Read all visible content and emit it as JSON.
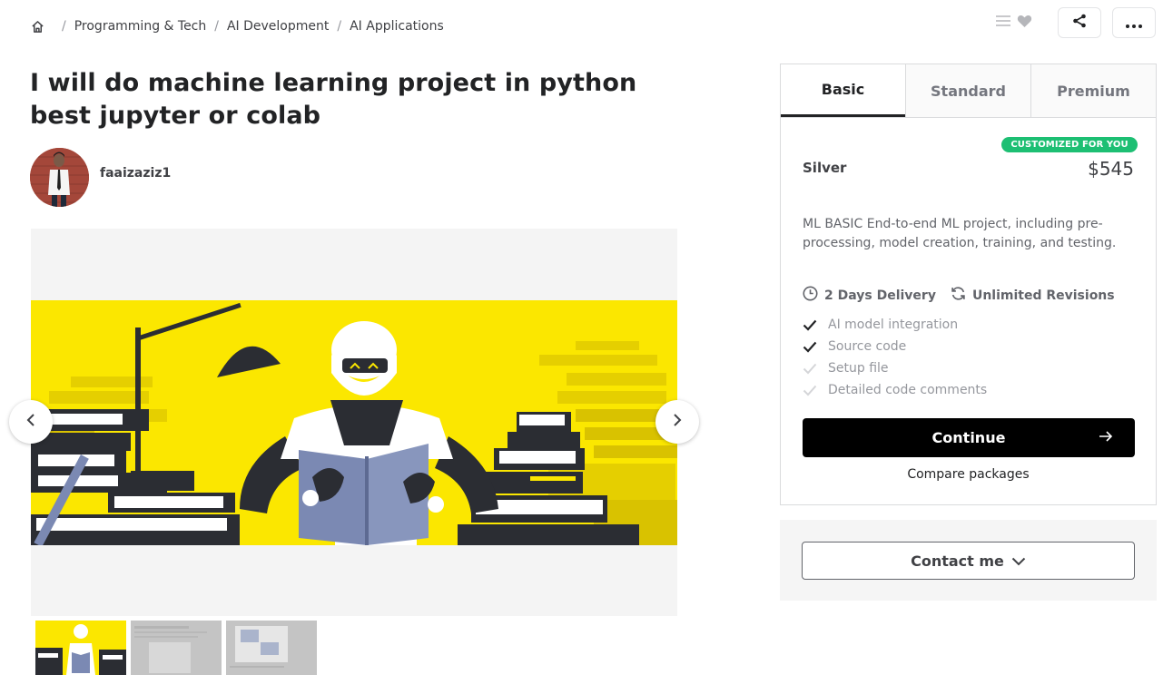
{
  "breadcrumb": {
    "items": [
      "Programming & Tech",
      "AI Development",
      "AI Applications"
    ],
    "separator": "/"
  },
  "gig": {
    "title": "I will do machine learning project in python best jupyter or colab",
    "seller_name": "faaizaziz1"
  },
  "packages": {
    "tabs": [
      "Basic",
      "Standard",
      "Premium"
    ],
    "active_tab": "Basic",
    "badge": "CUSTOMIZED FOR YOU",
    "name": "Silver",
    "price": "$545",
    "description": "ML BASIC End-to-end ML project, including pre-processing, model creation, training, and testing.",
    "delivery": "2 Days Delivery",
    "revisions": "Unlimited Revisions",
    "features": [
      {
        "label": "AI model integration",
        "included": true
      },
      {
        "label": "Source code",
        "included": true
      },
      {
        "label": "Setup file",
        "included": false
      },
      {
        "label": "Detailed code comments",
        "included": false
      }
    ],
    "continue_label": "Continue",
    "compare_label": "Compare packages"
  },
  "contact": {
    "label": "Contact me"
  },
  "colors": {
    "accent_green": "#1dbf73",
    "text_dark": "#222325",
    "slide_yellow": "#fbe700"
  },
  "icons": {
    "home": "home-icon",
    "list": "list-icon",
    "heart": "heart-icon",
    "share": "share-icon",
    "more": "more-dots-icon",
    "prev": "chevron-left-icon",
    "next": "chevron-right-icon",
    "clock": "clock-icon",
    "refresh": "refresh-icon",
    "check": "check-icon",
    "arrow": "arrow-right-icon",
    "chevron": "chevron-down-icon"
  }
}
